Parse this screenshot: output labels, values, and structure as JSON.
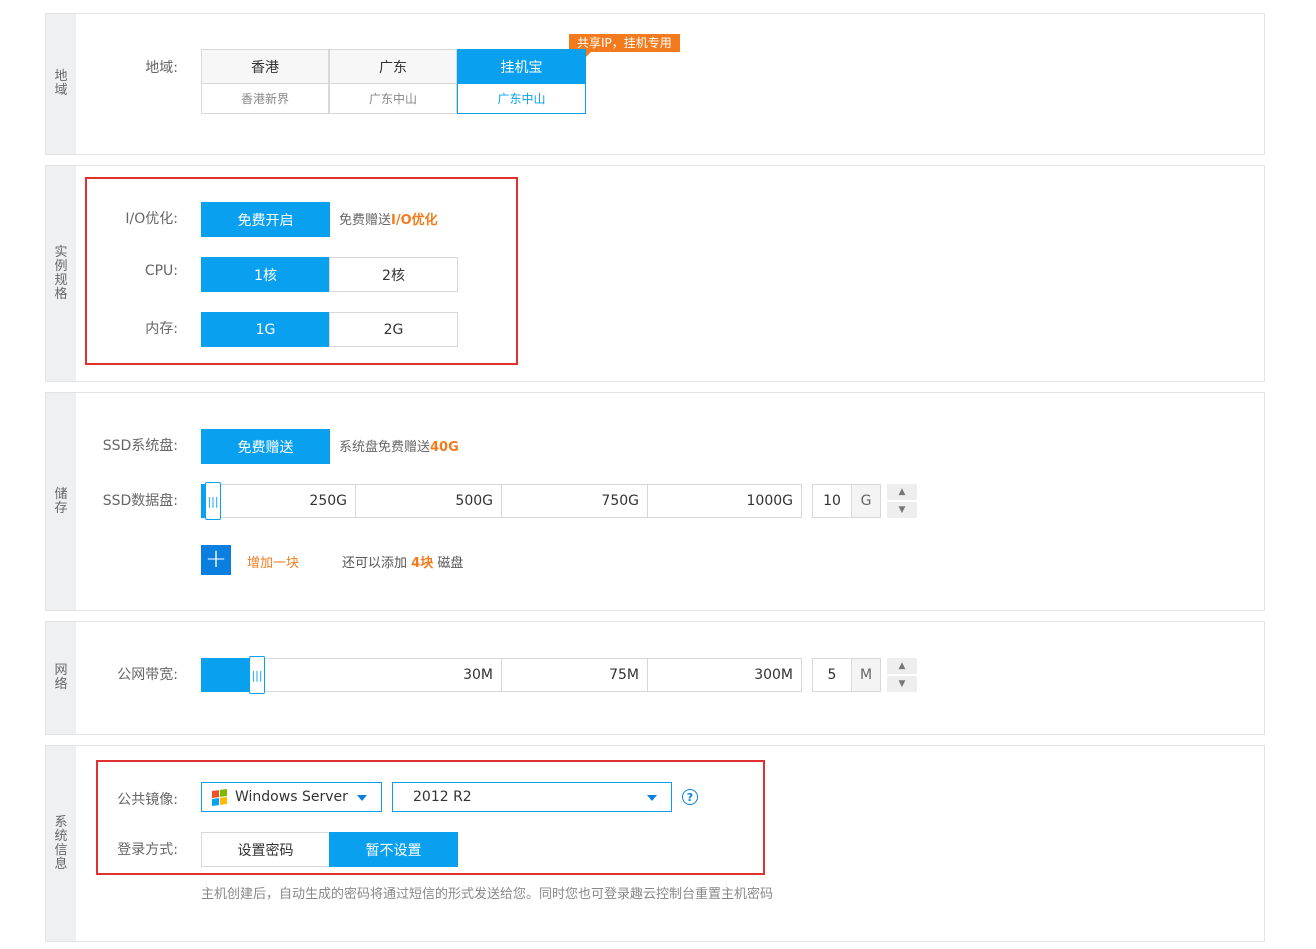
{
  "region": {
    "side_label": "地域",
    "label": "地域:",
    "tag": "共享IP，挂机专用",
    "options": [
      {
        "name": "香港",
        "sub": "香港新界",
        "selected": false
      },
      {
        "name": "广东",
        "sub": "广东中山",
        "selected": false
      },
      {
        "name": "挂机宝",
        "sub": "广东中山",
        "selected": true
      }
    ]
  },
  "instance": {
    "side_label": "实例规格",
    "io_label": "I/O优化:",
    "io_button": "免费开启",
    "io_note_prefix": "免费赠送",
    "io_note_highlight": "I/O优化",
    "cpu_label": "CPU:",
    "cpu_options": [
      "1核",
      "2核"
    ],
    "cpu_selected": "1核",
    "mem_label": "内存:",
    "mem_options": [
      "1G",
      "2G"
    ],
    "mem_selected": "1G"
  },
  "storage": {
    "side_label": "储存",
    "ssd_sys_label": "SSD系统盘:",
    "ssd_sys_button": "免费赠送",
    "ssd_sys_note_prefix": "系统盘免费赠送",
    "ssd_sys_note_highlight": "40G",
    "ssd_data_label": "SSD数据盘:",
    "ssd_data_ticks": [
      "250G",
      "500G",
      "750G",
      "1000G"
    ],
    "ssd_data_value": "10",
    "ssd_data_unit": "G",
    "add_label": "增加一块",
    "add_note_prefix": "还可以添加",
    "add_note_highlight": "4块",
    "add_note_suffix": "磁盘"
  },
  "network": {
    "side_label": "网络",
    "bandwidth_label": "公网带宽:",
    "bandwidth_ticks": [
      "30M",
      "75M",
      "300M"
    ],
    "bandwidth_value": "5",
    "bandwidth_unit": "M"
  },
  "system": {
    "side_label": "系统信息",
    "image_label": "公共镜像:",
    "os_select": "Windows Server",
    "version_select": "2012 R2",
    "login_label": "登录方式:",
    "login_options": [
      "设置密码",
      "暂不设置"
    ],
    "login_selected": "暂不设置",
    "hint": "主机创建后，自动生成的密码将通过短信的形式发送给您。同时您也可登录趣云控制台重置主机密码"
  },
  "colors": {
    "accent": "#0aa0f0",
    "orange": "#f37b1d",
    "highlight_border": "#e03030"
  }
}
